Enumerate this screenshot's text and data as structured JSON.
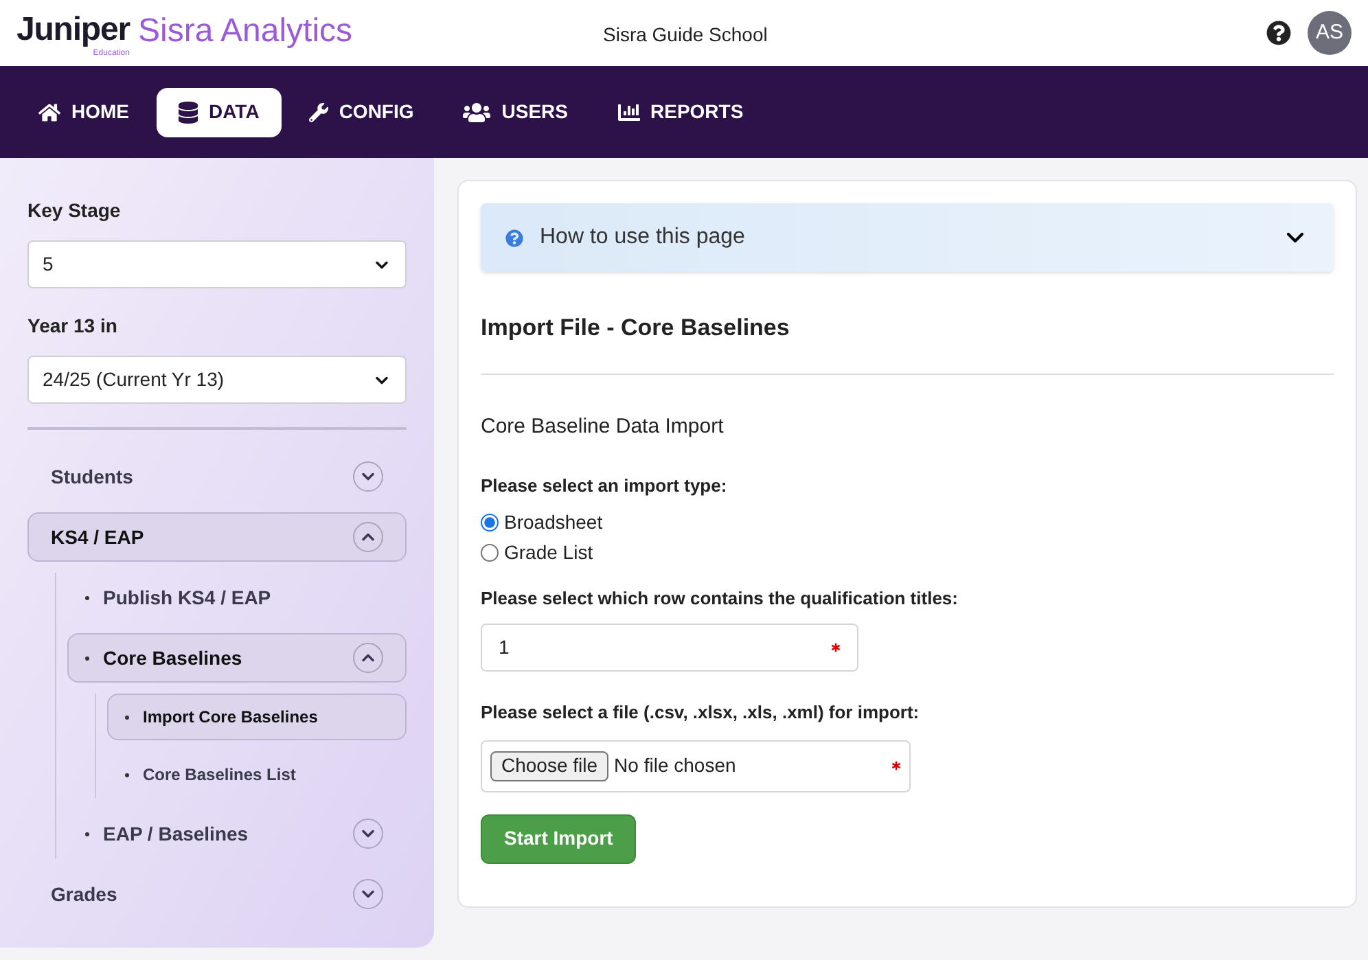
{
  "brand": {
    "name": "Juniper",
    "sub": "Education",
    "product": "Sisra Analytics"
  },
  "school": "Sisra Guide School",
  "user": {
    "initials": "AS"
  },
  "nav": [
    {
      "label": "HOME",
      "selected": false
    },
    {
      "label": "DATA",
      "selected": true
    },
    {
      "label": "CONFIG",
      "selected": false
    },
    {
      "label": "USERS",
      "selected": false
    },
    {
      "label": "REPORTS",
      "selected": false
    }
  ],
  "sidebar": {
    "filters": [
      {
        "label": "Key Stage",
        "value": "5"
      },
      {
        "label": "Year 13 in",
        "value": "24/25 (Current Yr 13)"
      }
    ],
    "items": [
      {
        "label": "Students",
        "expanded": false,
        "selected": false
      },
      {
        "label": "KS4 / EAP",
        "expanded": true,
        "selected": true,
        "children": [
          {
            "label": "Publish KS4 / EAP",
            "selected": false
          },
          {
            "label": "Core Baselines",
            "expanded": true,
            "selected": true,
            "children": [
              {
                "label": "Import Core Baselines",
                "selected": true
              },
              {
                "label": "Core Baselines List",
                "selected": false
              }
            ]
          },
          {
            "label": "EAP / Baselines",
            "expanded": false,
            "selected": false
          }
        ]
      },
      {
        "label": "Grades",
        "expanded": false,
        "selected": false
      }
    ]
  },
  "help": {
    "label": "How to use this page",
    "expanded": false
  },
  "page_title": "Import File - Core Baselines",
  "section_title": "Core Baseline Data Import",
  "import_type": {
    "label": "Please select an import type:",
    "options": [
      {
        "label": "Broadsheet",
        "selected": true
      },
      {
        "label": "Grade List",
        "selected": false
      }
    ]
  },
  "row_field": {
    "label": "Please select which row contains the qualification titles:",
    "value": "1"
  },
  "file_field": {
    "label": "Please select a file (.csv, .xlsx, .xls, .xml) for import:",
    "button": "Choose file",
    "status": "No file chosen"
  },
  "submit": "Start Import"
}
